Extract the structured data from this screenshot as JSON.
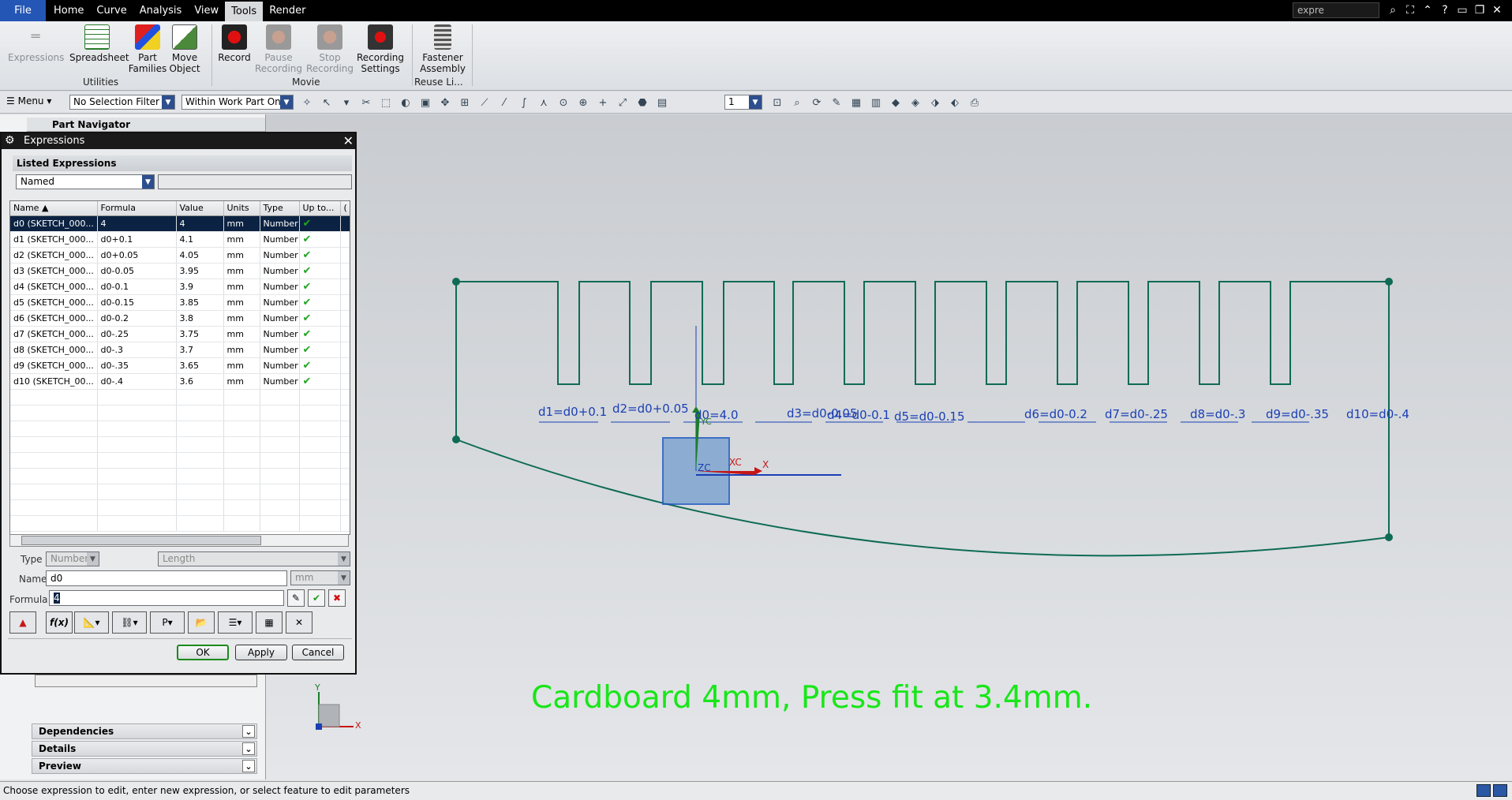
{
  "menubar": {
    "file": "File",
    "tabs": [
      "Home",
      "Curve",
      "Analysis",
      "View",
      "Tools",
      "Render"
    ],
    "active_tab": "Tools",
    "search_value": "expre"
  },
  "ribbon": {
    "expressions": "Expressions",
    "spreadsheet": "Spreadsheet",
    "part_families_1": "Part",
    "part_families_2": "Families",
    "move_object_1": "Move",
    "move_object_2": "Object",
    "utilities": "Utilities",
    "record": "Record",
    "pause_1": "Pause",
    "pause_2": "Recording",
    "stop_1": "Stop",
    "stop_2": "Recording",
    "rec_settings_1": "Recording",
    "rec_settings_2": "Settings",
    "movie": "Movie",
    "fastener_1": "Fastener",
    "fastener_2": "Assembly",
    "reuse": "Reuse Li..."
  },
  "toolbar": {
    "menu": "Menu",
    "selection_filter": "No Selection Filter",
    "scope": "Within Work Part Only",
    "layer": "1"
  },
  "partnav": {
    "title": "Part Navigator",
    "panels": [
      "Dependencies",
      "Details",
      "Preview"
    ]
  },
  "dialog": {
    "title": "Expressions",
    "listed_title": "Listed Expressions",
    "listed_value": "Named",
    "columns": [
      "Name",
      "Formula",
      "Value",
      "Units",
      "Type",
      "Up to...",
      "("
    ],
    "rows": [
      {
        "name": "d0  (SKETCH_000...",
        "formula": "4",
        "value": "4",
        "units": "mm",
        "type": "Number"
      },
      {
        "name": "d1  (SKETCH_000...",
        "formula": "d0+0.1",
        "value": "4.1",
        "units": "mm",
        "type": "Number"
      },
      {
        "name": "d2  (SKETCH_000...",
        "formula": "d0+0.05",
        "value": "4.05",
        "units": "mm",
        "type": "Number"
      },
      {
        "name": "d3  (SKETCH_000...",
        "formula": "d0-0.05",
        "value": "3.95",
        "units": "mm",
        "type": "Number"
      },
      {
        "name": "d4  (SKETCH_000...",
        "formula": "d0-0.1",
        "value": "3.9",
        "units": "mm",
        "type": "Number"
      },
      {
        "name": "d5  (SKETCH_000...",
        "formula": "d0-0.15",
        "value": "3.85",
        "units": "mm",
        "type": "Number"
      },
      {
        "name": "d6  (SKETCH_000...",
        "formula": "d0-0.2",
        "value": "3.8",
        "units": "mm",
        "type": "Number"
      },
      {
        "name": "d7  (SKETCH_000...",
        "formula": "d0-.25",
        "value": "3.75",
        "units": "mm",
        "type": "Number"
      },
      {
        "name": "d8  (SKETCH_000...",
        "formula": "d0-.3",
        "value": "3.7",
        "units": "mm",
        "type": "Number"
      },
      {
        "name": "d9  (SKETCH_000...",
        "formula": "d0-.35",
        "value": "3.65",
        "units": "mm",
        "type": "Number"
      },
      {
        "name": "d10  (SKETCH_00...",
        "formula": "d0-.4",
        "value": "3.6",
        "units": "mm",
        "type": "Number"
      }
    ],
    "type_label": "Type",
    "type_value": "Number",
    "dimensionality": "Length",
    "name_label": "Name",
    "name_value": "d0",
    "units_value": "mm",
    "formula_label": "Formula",
    "formula_value": "4",
    "fx": "f(x)",
    "ok": "OK",
    "apply": "Apply",
    "cancel": "Cancel"
  },
  "sketch": {
    "dims": [
      "d1=d0+0.1",
      "d2=d0+0.05",
      "d0=4.0",
      "d3=d0-0.05",
      "d4=d0-0.1",
      "d5=d0-0.15",
      "d6=d0-0.2",
      "d7=d0-.25",
      "d8=d0-.3",
      "d9=d0-.35",
      "d10=d0-.4"
    ],
    "csys_x": "X",
    "csys_xc": "XC",
    "csys_zc": "ZC",
    "csys_yc": "YC",
    "view_x": "X",
    "view_y": "Y",
    "caption": "Cardboard 4mm, Press fit at 3.4mm."
  },
  "status": {
    "message": "Choose expression to edit, enter new expression, or select feature to edit parameters"
  },
  "colors": {
    "sketch_line": "#0e6b55",
    "dimension": "#1a3fb5",
    "caption": "#19e619",
    "selection": "#0b2242",
    "file_tab": "#2456b5"
  }
}
